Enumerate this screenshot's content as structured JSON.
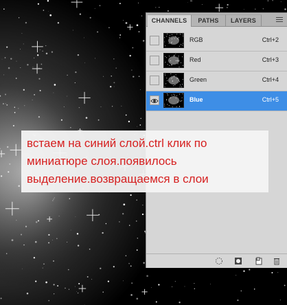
{
  "panel": {
    "tabs": [
      {
        "label": "CHANNELS",
        "active": true
      },
      {
        "label": "PATHS",
        "active": false
      },
      {
        "label": "LAYERS",
        "active": false
      }
    ],
    "channels": [
      {
        "name": "RGB",
        "shortcut": "Ctrl+2",
        "visible": false,
        "selected": false
      },
      {
        "name": "Red",
        "shortcut": "Ctrl+3",
        "visible": false,
        "selected": false
      },
      {
        "name": "Green",
        "shortcut": "Ctrl+4",
        "visible": false,
        "selected": false
      },
      {
        "name": "Blue",
        "shortcut": "Ctrl+5",
        "visible": true,
        "selected": true
      }
    ],
    "selection_color": "#3e8ee6",
    "bottom_icons": [
      "load-selection-icon",
      "save-selection-icon",
      "new-channel-icon",
      "delete-channel-icon"
    ]
  },
  "annotation": {
    "text": "встаем на синий слой.ctrl клик по миниатюре слоя.появилось выделение.возвращаемся в слои",
    "color": "#d62020"
  }
}
